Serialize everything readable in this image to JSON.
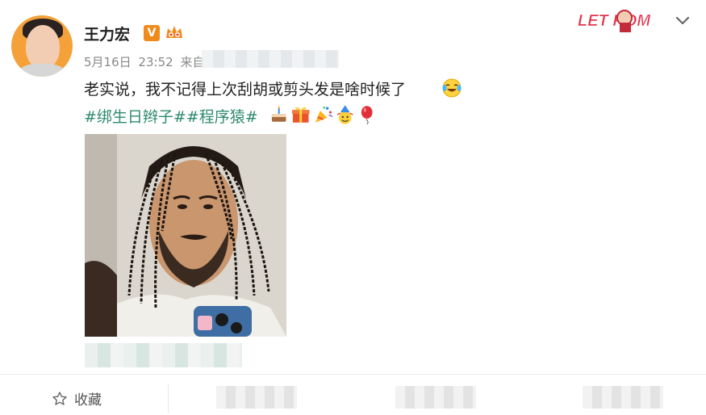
{
  "post": {
    "author": "王力宏",
    "verified_badge": "V",
    "date": "5月16日",
    "time": "23:52",
    "source_prefix": "来自",
    "text": "老实说，我不记得上次刮胡或剪头发是啥时候了",
    "hashtags": "#绑生日辫子##程序猿#",
    "emoji_icons": [
      "cake-icon",
      "gift-icon",
      "party-popper-icon",
      "party-hat-icon",
      "balloon-icon"
    ],
    "trailing_emoji": "laughing-tears-emoji",
    "image_description_icon": "selfie-photo"
  },
  "actions": {
    "collect_label": "收藏"
  },
  "header": {
    "logo_text": "LET ROM",
    "menu_icon": "chevron-down-icon"
  },
  "colors": {
    "accent_orange": "#f08a1b",
    "hashtag_green": "#2d8a6e",
    "avatar_bg": "#f4a13a"
  }
}
